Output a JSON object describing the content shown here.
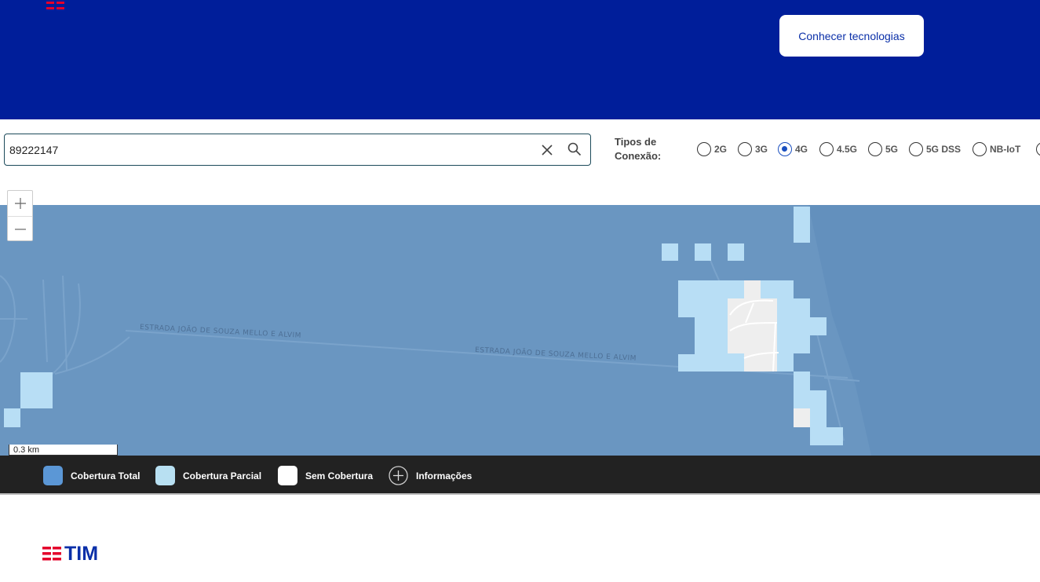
{
  "header": {
    "tech_button_label": "Conhecer tecnologias",
    "logo_icon": "tim-logo-icon",
    "background_color": "#001e9a"
  },
  "search": {
    "value": "89222147",
    "clear_icon": "close-icon",
    "search_icon": "search-icon"
  },
  "connection": {
    "label_line1": "Tipos de",
    "label_line2": "Conexão:",
    "options": [
      {
        "label": "2G",
        "checked": false
      },
      {
        "label": "3G",
        "checked": false
      },
      {
        "label": "4G",
        "checked": true
      },
      {
        "label": "4.5G",
        "checked": false
      },
      {
        "label": "5G",
        "checked": false
      },
      {
        "label": "5G DSS",
        "checked": false
      },
      {
        "label": "NB-IoT",
        "checked": false
      }
    ]
  },
  "map": {
    "zoom_in_label": "+",
    "zoom_out_label": "—",
    "scale_label": "0.3 km",
    "road_labels": [
      "ESTRADA JOÃO DE SOUZA MELLO E ALVIM",
      "ESTRADA JOÃO DE SOUZA MELLO E ALVIM"
    ],
    "colors": {
      "total": "#6a96c1",
      "partial": "#b8def5",
      "none": "#eeeeee"
    }
  },
  "legend": {
    "items": [
      {
        "label": "Cobertura Total",
        "color": "#5b97d6"
      },
      {
        "label": "Cobertura Parcial",
        "color": "#b8e0f2"
      },
      {
        "label": "Sem Cobertura",
        "color": "#ffffff"
      }
    ],
    "info_label": "Informações",
    "info_icon": "plus-circle-icon"
  },
  "footer": {
    "brand": "TIM"
  }
}
